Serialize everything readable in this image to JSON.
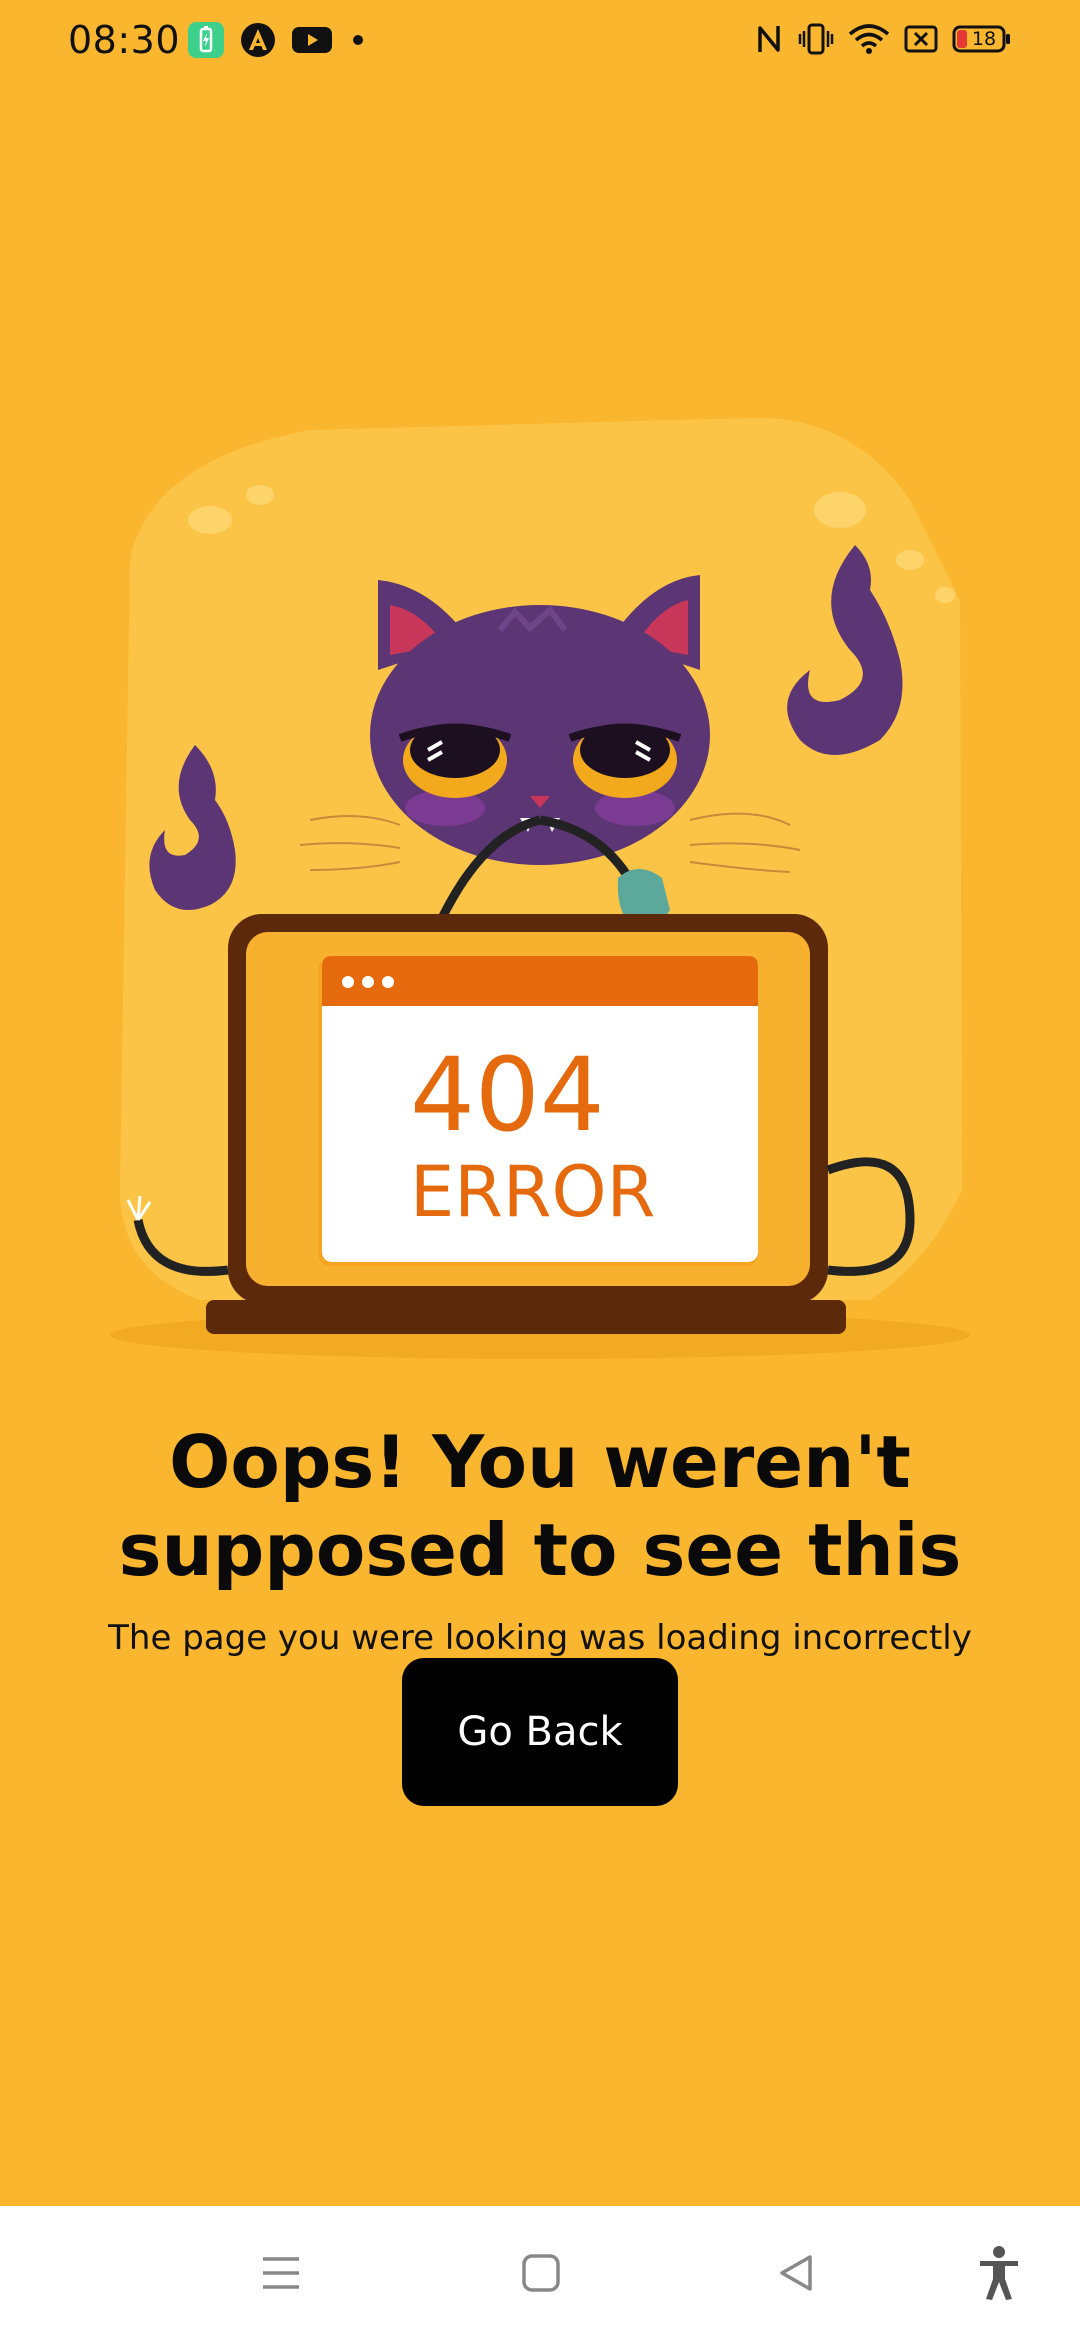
{
  "status_bar": {
    "time": "08:30",
    "battery_level": "18"
  },
  "illustration": {
    "code": "404",
    "label": "ERROR"
  },
  "error_page": {
    "headline_line1": "Oops! You weren't",
    "headline_line2": "supposed to see this",
    "message": "The page you were looking was loading incorrectly",
    "button_label": "Go Back"
  },
  "colors": {
    "background": "#FBB62F",
    "button": "#000000",
    "accent_orange": "#E56A0D",
    "cat_purple": "#5B3574"
  },
  "nav_bar": {
    "icons": [
      "menu-icon",
      "home-square-icon",
      "back-triangle-icon",
      "accessibility-icon"
    ]
  }
}
